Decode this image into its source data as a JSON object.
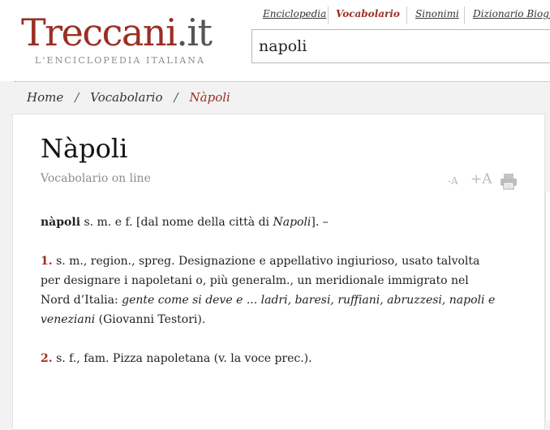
{
  "header": {
    "logo_main": "Treccani",
    "logo_dot_it": ".it",
    "logo_tagline": "L'ENCICLOPEDIA ITALIANA",
    "nav": [
      "Enciclopedia",
      "Vocabolario",
      "Sinonimi",
      "Dizionario Biografico"
    ],
    "active_nav": "Vocabolario",
    "search_value": "napoli"
  },
  "breadcrumb": {
    "items": [
      "Home",
      "Vocabolario",
      "Nàpoli"
    ],
    "separator": "/"
  },
  "article": {
    "title": "Nàpoli",
    "subtitle": "Vocabolario on line",
    "font_smaller": "-A",
    "font_larger": "+A",
    "headword": "nàpoli",
    "head_gram": " s. m. e f. [dal nome della città di ",
    "head_city": "Napoli",
    "head_end": "]. –",
    "def1_num": "1.",
    "def1_text": " s. m., region., spreg. Designazione e appellativo ingiurioso, usato talvolta per designare i napoletani o, più generalm., un meridionale immigrato nel Nord d’Italia: ",
    "def1_example": "gente come si deve e ... ladri, baresi, ruffiani, abruzzesi, napoli e veneziani",
    "def1_source": " (Giovanni Testori).",
    "def2_num": "2.",
    "def2_text": " s. f., fam. Pizza napoletana (v. la voce prec.)."
  },
  "colors": {
    "brand": "#9a2f24",
    "muted": "#8c8c8c"
  },
  "icons": [
    "print-icon"
  ]
}
